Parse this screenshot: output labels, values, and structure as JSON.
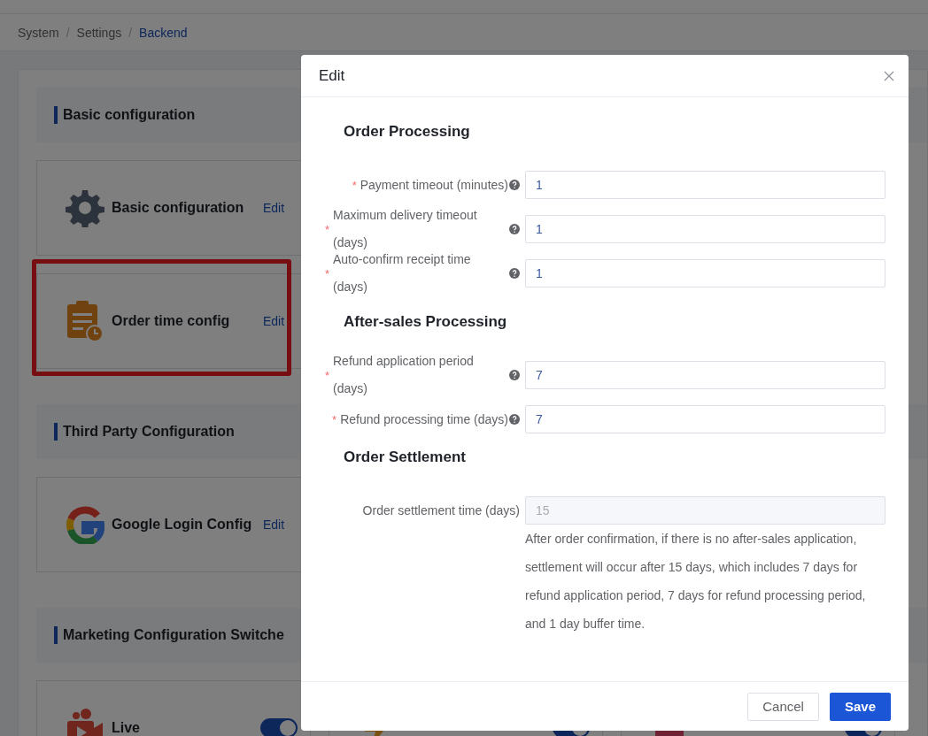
{
  "breadcrumb_separator": "/",
  "breadcrumb": [
    {
      "label": "System",
      "current": false
    },
    {
      "label": "Settings",
      "current": false
    },
    {
      "label": "Backend",
      "current": true
    }
  ],
  "sections": [
    {
      "title": "Basic configuration",
      "cards": [
        {
          "kind": "gear",
          "title": "Basic configuration",
          "action": "Edit",
          "highlighted": false
        },
        {
          "kind": "order",
          "title": "Order time config",
          "action": "Edit",
          "highlighted": true
        }
      ]
    },
    {
      "title": "Third Party Configuration",
      "cards": [
        {
          "kind": "google",
          "title": "Google Login Config",
          "action": "Edit",
          "highlighted": false
        }
      ]
    },
    {
      "title": "Marketing Configuration Switche",
      "cards": [
        {
          "kind": "live",
          "title": "Live",
          "on": true
        },
        {
          "kind": "spike",
          "on": true
        },
        {
          "kind": "group",
          "on": true
        }
      ]
    }
  ],
  "dialog": {
    "title": "Edit",
    "required_mark": "*",
    "groups": [
      {
        "title": "Order Processing",
        "fields": [
          {
            "label": "Payment timeout (minutes)",
            "required": true,
            "help": true,
            "value": "1",
            "disabled": false
          },
          {
            "label": "Maximum delivery timeout (days)",
            "required": true,
            "help": true,
            "value": "1",
            "disabled": false
          },
          {
            "label": "Auto-confirm receipt time (days)",
            "required": true,
            "help": true,
            "value": "1",
            "disabled": false
          }
        ]
      },
      {
        "title": "After-sales Processing",
        "fields": [
          {
            "label": "Refund application period (days)",
            "required": true,
            "help": true,
            "value": "7",
            "disabled": false
          },
          {
            "label": "Refund processing time (days)",
            "required": true,
            "help": true,
            "value": "7",
            "disabled": false
          }
        ]
      },
      {
        "title": "Order Settlement",
        "fields": [
          {
            "label": "Order settlement time (days)",
            "required": false,
            "help": false,
            "value": "15",
            "disabled": true,
            "note": "After order confirmation, if there is no after-sales application, settlement will occur after 15 days, which includes 7 days for refund application period, 7 days for refund processing period, and 1 day buffer time."
          }
        ]
      }
    ],
    "buttons": [
      {
        "label": "Cancel",
        "primary": false
      },
      {
        "label": "Save",
        "primary": true
      }
    ]
  }
}
